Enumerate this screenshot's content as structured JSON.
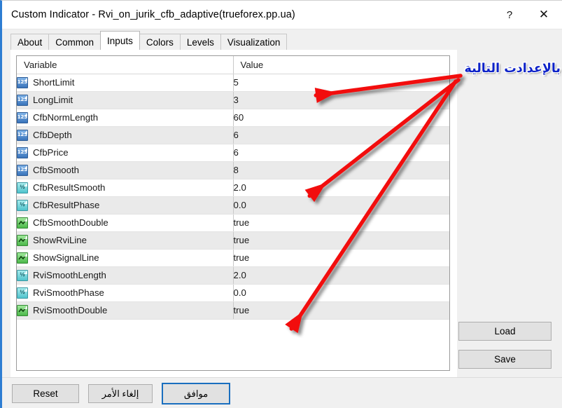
{
  "window": {
    "title": "Custom Indicator - Rvi_on_jurik_cfb_adaptive(trueforex.pp.ua)",
    "help_label": "?",
    "close_label": "✕"
  },
  "tabs": [
    {
      "label": "About",
      "active": false
    },
    {
      "label": "Common",
      "active": false
    },
    {
      "label": "Inputs",
      "active": true
    },
    {
      "label": "Colors",
      "active": false
    },
    {
      "label": "Levels",
      "active": false
    },
    {
      "label": "Visualization",
      "active": false
    }
  ],
  "table": {
    "headers": {
      "variable": "Variable",
      "value": "Value"
    },
    "rows": [
      {
        "icon": "integer-icon",
        "type": "int",
        "variable": "ShortLimit",
        "value": "5"
      },
      {
        "icon": "integer-icon",
        "type": "int",
        "variable": "LongLimit",
        "value": "3"
      },
      {
        "icon": "integer-icon",
        "type": "int",
        "variable": "CfbNormLength",
        "value": "60"
      },
      {
        "icon": "integer-icon",
        "type": "int",
        "variable": "CfbDepth",
        "value": "6"
      },
      {
        "icon": "integer-icon",
        "type": "int",
        "variable": "CfbPrice",
        "value": "6"
      },
      {
        "icon": "integer-icon",
        "type": "int",
        "variable": "CfbSmooth",
        "value": "8"
      },
      {
        "icon": "double-icon",
        "type": "dbl",
        "variable": "CfbResultSmooth",
        "value": "2.0"
      },
      {
        "icon": "double-icon",
        "type": "dbl",
        "variable": "CfbResultPhase",
        "value": "0.0"
      },
      {
        "icon": "boolean-icon",
        "type": "bool",
        "variable": "CfbSmoothDouble",
        "value": "true"
      },
      {
        "icon": "boolean-icon",
        "type": "bool",
        "variable": "ShowRviLine",
        "value": "true"
      },
      {
        "icon": "boolean-icon",
        "type": "bool",
        "variable": "ShowSignalLine",
        "value": "true"
      },
      {
        "icon": "double-icon",
        "type": "dbl",
        "variable": "RviSmoothLength",
        "value": "2.0"
      },
      {
        "icon": "double-icon",
        "type": "dbl",
        "variable": "RviSmoothPhase",
        "value": "0.0"
      },
      {
        "icon": "boolean-icon",
        "type": "bool",
        "variable": "RviSmoothDouble",
        "value": "true"
      }
    ]
  },
  "side_buttons": {
    "load": "Load",
    "save": "Save"
  },
  "footer": {
    "reset": "Reset",
    "cancel": "إلغاء الأمر",
    "ok": "موافق"
  },
  "annotation": {
    "text": "بالإعدادت التالية",
    "arrow_color": "#f20f0f",
    "text_color": "#0d22c8"
  }
}
